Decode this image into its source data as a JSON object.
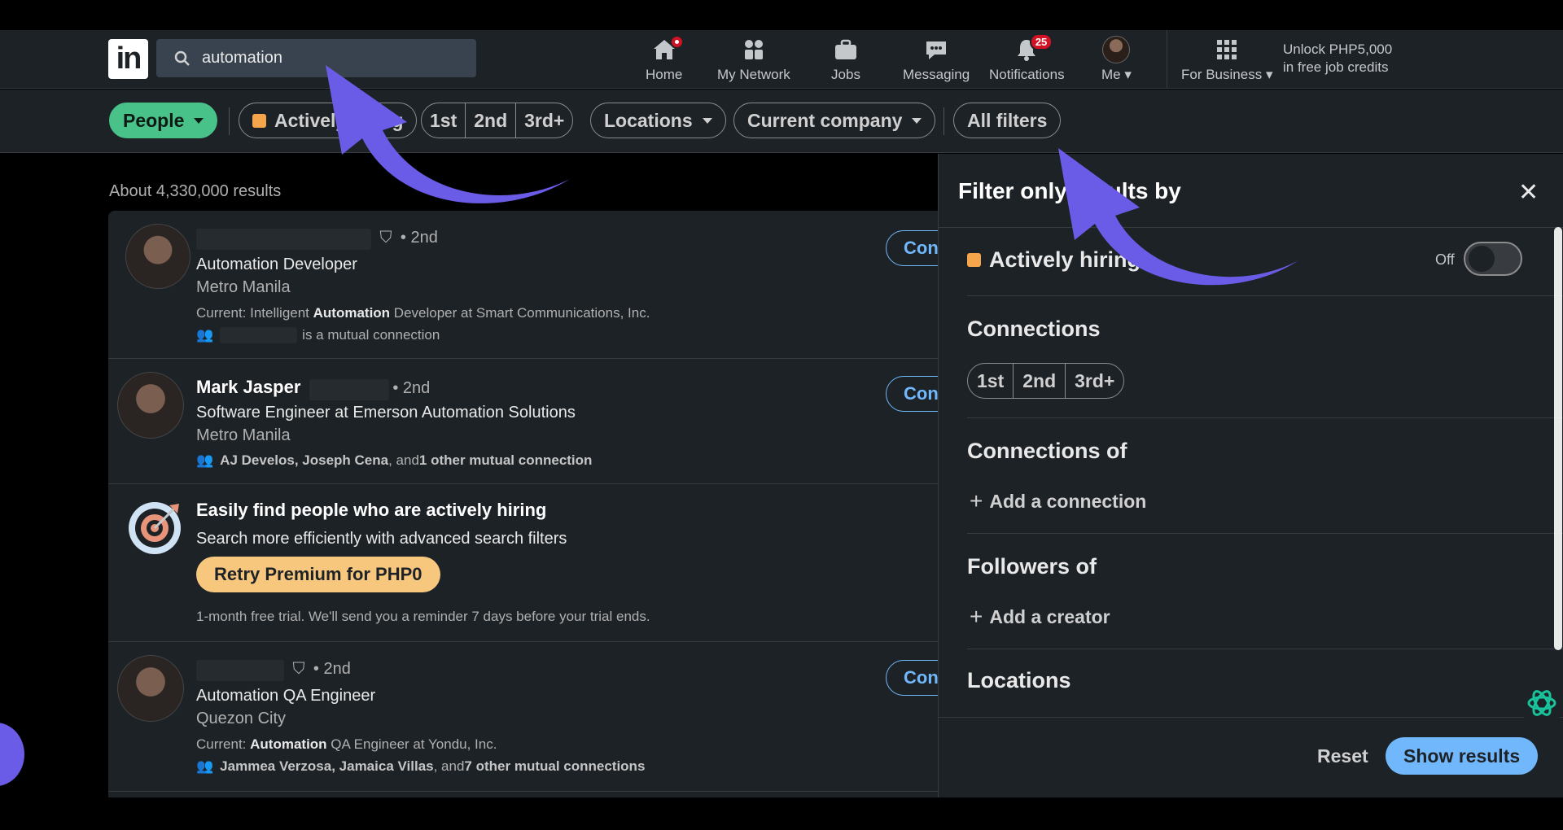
{
  "navbar": {
    "search_value": "automation",
    "items": [
      {
        "label": "Home",
        "icon": "home-icon"
      },
      {
        "label": "My Network",
        "icon": "network-icon"
      },
      {
        "label": "Jobs",
        "icon": "briefcase-icon"
      },
      {
        "label": "Messaging",
        "icon": "messaging-icon"
      },
      {
        "label": "Notifications",
        "icon": "bell-icon",
        "badge": "25"
      },
      {
        "label": "Me",
        "icon": "avatar"
      }
    ],
    "for_business": "For Business",
    "unlock_line1": "Unlock PHP5,000",
    "unlock_line2": "in free job credits"
  },
  "filters": {
    "people": "People",
    "actively_hiring": "Actively hiring",
    "degrees": [
      "1st",
      "2nd",
      "3rd+"
    ],
    "locations": "Locations",
    "current_company": "Current company",
    "all_filters": "All filters"
  },
  "results": {
    "count": "About 4,330,000 results",
    "connect_label": "Connect",
    "items": [
      {
        "name": "",
        "degree": "• 2nd",
        "title": "Automation Developer",
        "location": "Metro Manila",
        "current_prefix": "Current: Intelligent ",
        "current_bold": "Automation",
        "current_suffix": " Developer at Smart Communications, Inc.",
        "mutual": "is a mutual connection"
      },
      {
        "name": "Mark Jasper",
        "degree": "• 2nd",
        "title": "Software Engineer at Emerson Automation Solutions",
        "location": "Metro Manila",
        "mutual_names": "AJ Develos, Joseph Cena",
        "mutual_and": ", and ",
        "mutual_other": "1 other mutual connection"
      },
      {
        "promo_title": "Easily find people who are actively hiring",
        "promo_sub": "Search more efficiently with advanced search filters",
        "promo_button": "Retry Premium for PHP0",
        "promo_note": "1-month free trial. We'll send you a reminder 7 days before your trial ends."
      },
      {
        "name": "",
        "degree": "• 2nd",
        "title": "Automation QA Engineer",
        "location": "Quezon City",
        "current_prefix": "Current: ",
        "current_bold": "Automation",
        "current_suffix": " QA Engineer at Yondu, Inc.",
        "mutual_names": "Jammea Verzosa, Jamaica Villas",
        "mutual_and": ", and ",
        "mutual_other": "7 other mutual connections"
      }
    ]
  },
  "panel": {
    "title": "Filter only results by",
    "actively_hiring": "Actively hiring",
    "toggle_state": "Off",
    "connections": "Connections",
    "degrees": [
      "1st",
      "2nd",
      "3rd+"
    ],
    "connections_of": "Connections of",
    "add_connection": "Add a connection",
    "followers_of": "Followers of",
    "add_creator": "Add a creator",
    "locations": "Locations",
    "reset": "Reset",
    "show_results": "Show results"
  },
  "colors": {
    "accent": "#71b7fb",
    "people_pill": "#49c28a",
    "premium": "#f8c77e",
    "annotation_arrow": "#6b5ce7",
    "hiring": "#f5a54c"
  }
}
